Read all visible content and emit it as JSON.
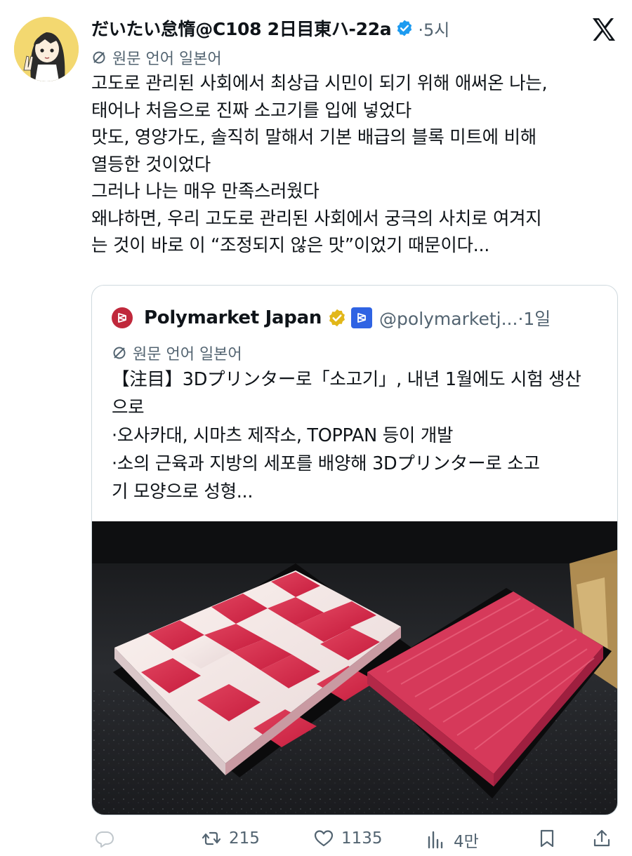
{
  "author": {
    "display_name": "だいたい怠惰@C108 2日目東ハ-22a",
    "time": "5시"
  },
  "translation_label": "원문 언어 일본어",
  "tweet_lines": [
    "고도로 관리된 사회에서 최상급 시민이 되기 위해 애써온 나는,",
    "태어나 처음으로 진짜 소고기를 입에 넣었다",
    "맛도, 영양가도, 솔직히 말해서 기본 배급의 블록 미트에 비해",
    "열등한 것이었다",
    "그러나 나는 매우 만족스러웠다",
    "왜냐하면, 우리 고도로 관리된 사회에서 궁극의 사치로 여겨지",
    "는 것이 바로 이 “조정되지 않은 맛”이었기 때문이다..."
  ],
  "quote": {
    "name": "Polymarket Japan",
    "handle": "@polymarketj...",
    "time": "1일",
    "translation_label": "원문 언어 일본어",
    "lines": [
      "【注目】3Dプリンター로「소고기」, 내년 1월에도 시험 생산",
      "으로",
      "·오사카대, 시마츠 제작소, TOPPAN 등이 개발",
      "·소의 근육과 지방의 세포를 배양해 3Dプリンター로 소고",
      "기 모양으로 성형..."
    ]
  },
  "actions": {
    "retweets": "215",
    "likes": "1135",
    "views": "4만"
  },
  "colors": {
    "text": "#0f1419",
    "muted": "#536471",
    "verified_blue": "#1d9bf0",
    "gold_badge": "#e2b719",
    "polymarket_red": "#c0283b",
    "affiliate_blue": "#2f63e3"
  }
}
